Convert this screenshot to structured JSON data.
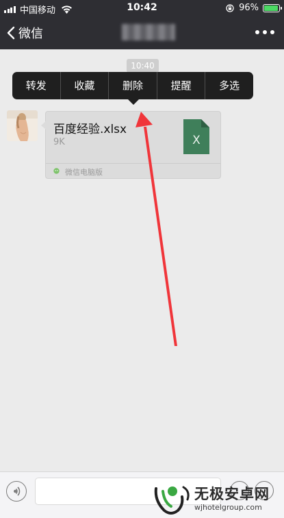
{
  "status_bar": {
    "carrier": "中国移动",
    "time": "10:42",
    "battery_percent": "96%",
    "battery_level": 0.96,
    "signal_bars": 4,
    "icons": [
      "signal-icon",
      "wifi-icon",
      "orientation-lock-icon",
      "battery-icon"
    ]
  },
  "nav": {
    "back_label": "微信",
    "title": "",
    "more_icon": "more-dots-icon"
  },
  "chat": {
    "timestamp": "10:40",
    "context_menu": [
      "转发",
      "收藏",
      "删除",
      "提醒",
      "多选"
    ],
    "message": {
      "file_name": "百度经验.xlsx",
      "file_size": "9K",
      "file_icon_letter": "X",
      "source": "微信电脑版"
    }
  },
  "input_bar": {
    "placeholder": "",
    "icons": [
      "voice-icon",
      "emoji-icon",
      "plus-icon"
    ]
  },
  "watermark": {
    "title": "无极安卓网",
    "url": "wjhotelgroup.com"
  },
  "colors": {
    "header_bg": "#2e2e33",
    "chat_bg": "#ebebeb",
    "menu_bg": "#1f1f1f",
    "excel_green": "#3f7f5a",
    "annotation_red": "#f0353a",
    "battery_green": "#4cd964"
  }
}
